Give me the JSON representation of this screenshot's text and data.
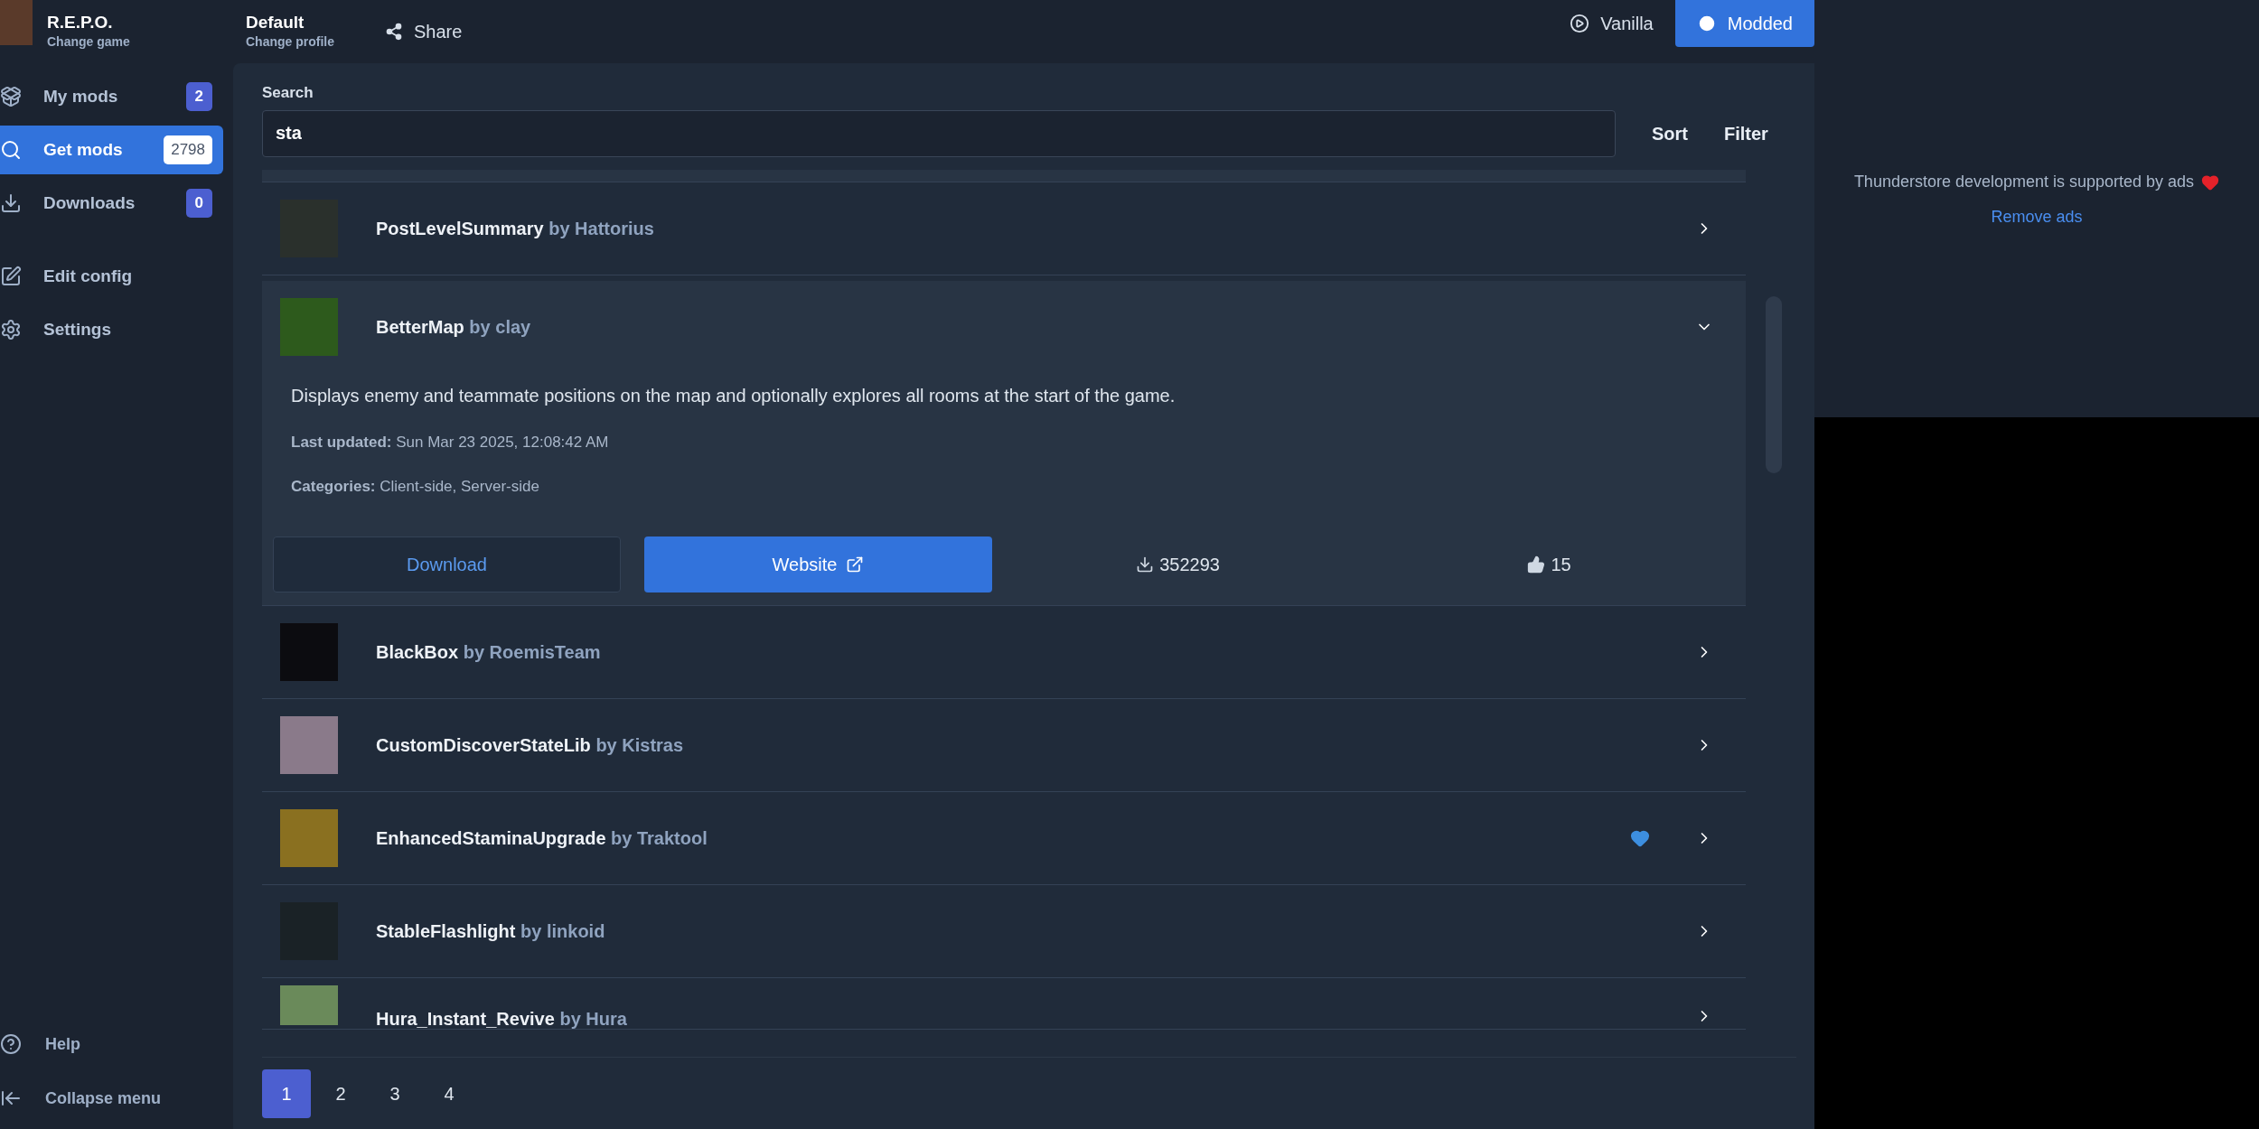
{
  "header": {
    "game": {
      "title": "R.E.P.O.",
      "subtitle": "Change game"
    },
    "profile": {
      "title": "Default",
      "subtitle": "Change profile"
    },
    "share": "Share",
    "modes": [
      {
        "label": "Vanilla",
        "selected": false
      },
      {
        "label": "Modded",
        "selected": true
      }
    ]
  },
  "sidebar": {
    "items": [
      {
        "kind": "mods",
        "label": "My mods",
        "badge": "2",
        "selected": false
      },
      {
        "kind": "search",
        "label": "Get mods",
        "badge": "2798",
        "selected": true
      },
      {
        "kind": "downloads",
        "label": "Downloads",
        "badge": "0",
        "selected": false
      },
      {
        "kind": "config",
        "label": "Edit config",
        "selected": false
      },
      {
        "kind": "settings",
        "label": "Settings",
        "selected": false
      }
    ],
    "footer": [
      {
        "kind": "help",
        "label": "Help"
      },
      {
        "kind": "collapse",
        "label": "Collapse menu"
      }
    ]
  },
  "search": {
    "label": "Search",
    "value": "sta",
    "sort": "Sort",
    "filter": "Filter"
  },
  "mods": [
    {
      "name": "PostLevelSummary",
      "author": "by Hattorius",
      "expanded": false,
      "favorite": false
    },
    {
      "name": "BetterMap",
      "author": "by clay",
      "expanded": true,
      "favorite": false,
      "description": "Displays enemy and teammate positions on the map and optionally explores all rooms at the start of the game.",
      "details": [
        {
          "label": "Last updated:",
          "value": "Sun Mar 23 2025, 12:08:42 AM"
        },
        {
          "label": "Categories:",
          "value": "Client-side, Server-side"
        }
      ],
      "download": "Download",
      "website": "Website",
      "downloads": "352293",
      "likes": "15"
    },
    {
      "name": "BlackBox",
      "author": "by RoemisTeam",
      "expanded": false,
      "favorite": false
    },
    {
      "name": "CustomDiscoverStateLib",
      "author": "by Kistras",
      "expanded": false,
      "favorite": false
    },
    {
      "name": "EnhancedStaminaUpgrade",
      "author": "by Traktool",
      "expanded": false,
      "favorite": true
    },
    {
      "name": "StableFlashlight",
      "author": "by linkoid",
      "expanded": false,
      "favorite": false
    },
    {
      "name": "Hura_Instant_Revive",
      "author": "by Hura",
      "expanded": false,
      "favorite": false
    }
  ],
  "pagination": [
    {
      "label": "1",
      "selected": true
    },
    {
      "label": "2",
      "selected": false
    },
    {
      "label": "3",
      "selected": false
    },
    {
      "label": "4",
      "selected": false
    }
  ],
  "ad": {
    "text": "Thunderstore development is supported by ads",
    "link": "Remove ads"
  }
}
